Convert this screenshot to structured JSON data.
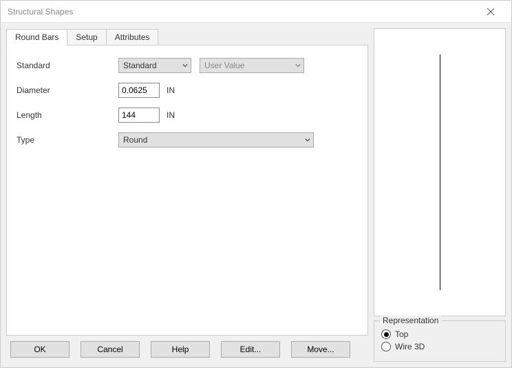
{
  "window": {
    "title": "Structural Shapes"
  },
  "tabs": [
    {
      "label": "Round Bars",
      "active": true
    },
    {
      "label": "Setup",
      "active": false
    },
    {
      "label": "Attributes",
      "active": false
    }
  ],
  "form": {
    "standard_label": "Standard",
    "standard_value": "Standard",
    "user_value": "User Value",
    "diameter_label": "Diameter",
    "diameter_value": "0.0625",
    "diameter_unit": "IN",
    "length_label": "Length",
    "length_value": "144",
    "length_unit": "IN",
    "type_label": "Type",
    "type_value": "Round"
  },
  "buttons": {
    "ok": "OK",
    "cancel": "Cancel",
    "help": "Help",
    "edit": "Edit...",
    "move": "Move..."
  },
  "representation": {
    "legend": "Representation",
    "top": "Top",
    "wire3d": "Wire 3D",
    "selected": "top"
  }
}
